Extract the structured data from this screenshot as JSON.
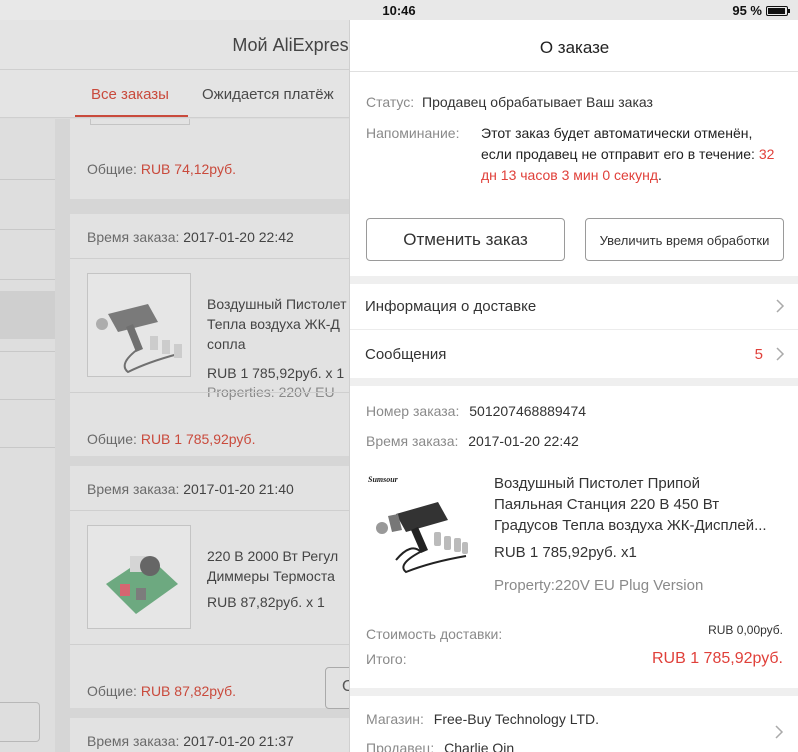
{
  "status_bar": {
    "time": "10:46",
    "battery": "95 %"
  },
  "background": {
    "header_title": "Мой AliExpress",
    "tabs": [
      {
        "label": "Все заказы",
        "active": true
      },
      {
        "label": "Ожидается платёж",
        "active": false
      }
    ],
    "orders": [
      {
        "total_label": "Общие:",
        "total": "RUB 74,12руб."
      },
      {
        "time_label": "Время заказа:",
        "time": "2017-01-20 22:42",
        "title": "Воздушный Пистолет Тепла воздуха ЖК-Д сопла",
        "title_lines": [
          "Воздушный Пистолет",
          "Тепла воздуха ЖК-Д",
          "сопла"
        ],
        "price": "RUB 1 785,92руб. х 1",
        "properties": "Properties: 220V EU",
        "total_label": "Общие:",
        "total": "RUB 1 785,92руб."
      },
      {
        "time_label": "Время заказа:",
        "time": "2017-01-20 21:40",
        "title_lines": [
          "220 В 2000 Вт Регул",
          "Диммеры Термоста"
        ],
        "price": "RUB 87,82руб. х 1",
        "total_label": "Общие:",
        "total": "RUB 87,82руб.",
        "button_label": "О"
      },
      {
        "time_label": "Время заказа:",
        "time": "2017-01-20 21:37"
      }
    ]
  },
  "panel": {
    "title": "О заказе",
    "status_label": "Статус:",
    "status_value": "Продавец обрабатывает Ваш заказ",
    "reminder_label": "Напоминание:",
    "reminder_text": "Этот заказ будет автоматически отменён, если продавец не отправит его в течение:",
    "reminder_time": "32 дн 13 часов 3 мин 0 секунд",
    "reminder_end": ".",
    "cancel_button": "Отменить заказ",
    "extend_button": "Увеличить время обработки",
    "delivery_info": "Информация о доставке",
    "messages": "Сообщения",
    "messages_count": "5",
    "order_number_label": "Номер заказа:",
    "order_number": "501207468889474",
    "order_time_label": "Время заказа:",
    "order_time": "2017-01-20 22:42",
    "product": {
      "title_lines": [
        "Воздушный Пистолет Припой",
        "Паяльная Станция 220 В 450 Вт",
        "Градусов Тепла воздуха ЖК-Дисплей..."
      ],
      "price": "RUB 1 785,92руб. x1",
      "property": "Property:220V EU Plug Version",
      "brand_mark": "Sumsour"
    },
    "shipping_label": "Стоимость доставки:",
    "shipping_value": "RUB 0,00руб.",
    "total_label": "Итого:",
    "total_value": "RUB 1 785,92руб.",
    "store_label": "Магазин:",
    "store_value": "Free-Buy Technology LTD.",
    "seller_label": "Продавец:",
    "seller_value": "Charlie Qin"
  }
}
